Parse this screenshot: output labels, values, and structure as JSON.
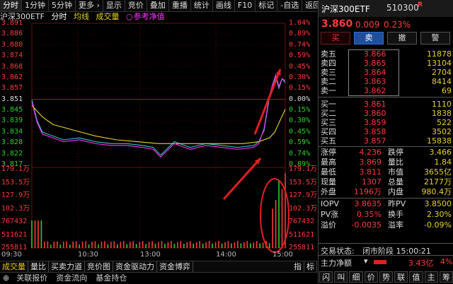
{
  "toolbar": {
    "items": [
      "分时",
      "1分钟",
      "5分钟",
      "更多 ›",
      "显示",
      "竞价",
      "叠加",
      "重播",
      "统计",
      "画线",
      "F10",
      "标记",
      "-自选"
    ],
    "back": "返回"
  },
  "chart": {
    "name": "沪深300ETF",
    "mode": "分时",
    "legend_avg": "均线",
    "legend_vol": "成交量",
    "legend_nav": "参考净值",
    "price_ticks": [
      "3.891",
      "3.886",
      "3.880",
      "3.874",
      "3.868",
      "3.862",
      "3.857",
      "3.851",
      "3.845",
      "3.839",
      "3.834",
      "3.828",
      "3.822",
      "3.817"
    ],
    "pct_ticks": [
      "1.04%",
      "0.89%",
      "0.74%",
      "0.59%",
      "0.45%",
      "0.30%",
      "0.15%",
      "0.00%",
      "0.15%",
      "0.30%",
      "0.45%",
      "0.59%",
      "0.74%",
      "0.89%"
    ],
    "vol_ticks": [
      "179.1万",
      "153.5万",
      "127.9万",
      "102.3万",
      "767432",
      "511621",
      "255811"
    ],
    "time_ticks": [
      "09:30",
      "10:30",
      "13:00",
      "14:00",
      "15:00"
    ],
    "colors": {
      "up": "#ff3b3b",
      "down": "#2bd12b",
      "price": "#ffffff",
      "avg": "#e6d32a",
      "nav": "#ff33ff",
      "vol_alt": "#2ec4c4",
      "circle": "#e02020"
    }
  },
  "chart_data": {
    "type": "line",
    "title": "沪深300ETF",
    "x_range": [
      "09:30",
      "15:00"
    ],
    "y_range": [
      3.817,
      3.891
    ],
    "prev_close": 3.851,
    "series": [
      {
        "name": "分时",
        "x": [
          0,
          5,
          10,
          20,
          30,
          45,
          60,
          75,
          90,
          105,
          115,
          120,
          122,
          135,
          150,
          165,
          180,
          195,
          210,
          215,
          220,
          225,
          228,
          231,
          234,
          237,
          240
        ],
        "values": [
          3.851,
          3.84,
          3.834,
          3.832,
          3.83,
          3.831,
          3.829,
          3.828,
          3.828,
          3.827,
          3.826,
          3.823,
          3.822,
          3.829,
          3.826,
          3.828,
          3.827,
          3.826,
          3.827,
          3.829,
          3.835,
          3.852,
          3.858,
          3.863,
          3.857,
          3.862,
          3.86
        ]
      },
      {
        "name": "均线",
        "x": [
          0,
          10,
          20,
          40,
          60,
          80,
          100,
          120,
          140,
          160,
          180,
          200,
          215,
          225,
          230,
          235,
          240
        ],
        "values": [
          3.848,
          3.842,
          3.838,
          3.835,
          3.832,
          3.83,
          3.829,
          3.828,
          3.828,
          3.828,
          3.828,
          3.828,
          3.829,
          3.831,
          3.834,
          3.84,
          3.846
        ]
      },
      {
        "name": "参考净值",
        "x": [
          0,
          5,
          10,
          20,
          30,
          45,
          60,
          75,
          90,
          105,
          115,
          120,
          122,
          135,
          150,
          165,
          180,
          195,
          210,
          215,
          220,
          225,
          228,
          231,
          234,
          237,
          240
        ],
        "values": [
          3.85,
          3.839,
          3.833,
          3.831,
          3.829,
          3.83,
          3.828,
          3.827,
          3.827,
          3.826,
          3.825,
          3.822,
          3.821,
          3.828,
          3.825,
          3.827,
          3.826,
          3.825,
          3.826,
          3.828,
          3.836,
          3.853,
          3.859,
          3.864,
          3.858,
          3.862,
          3.861
        ]
      }
    ],
    "volume": {
      "ylim": [
        0,
        1791000
      ]
    }
  },
  "bottom_tabs": [
    "成交量",
    "量比",
    "买卖力道",
    "竞价图",
    "资金驱动力",
    "资金博弈"
  ],
  "bottom_right": [
    "指",
    "标"
  ],
  "bottom_links": [
    "关联报价",
    "资金流向",
    "基金持仓"
  ],
  "quote": {
    "name": "沪深300ETF",
    "code": "510300",
    "badge": "R",
    "price": "3.860",
    "change": "0.009",
    "pct": "0.23%",
    "buttons": [
      "买",
      "卖",
      "撤",
      "警"
    ],
    "asks": [
      {
        "label": "卖五",
        "price": "3.866",
        "vol": "11878"
      },
      {
        "label": "卖四",
        "price": "3.865",
        "vol": "13104"
      },
      {
        "label": "卖三",
        "price": "3.864",
        "vol": "2704"
      },
      {
        "label": "卖二",
        "price": "3.863",
        "vol": "8414"
      },
      {
        "label": "卖一",
        "price": "3.862",
        "vol": "69"
      }
    ],
    "bids": [
      {
        "label": "买一",
        "price": "3.861",
        "vol": "1110"
      },
      {
        "label": "买二",
        "price": "3.860",
        "vol": "1838"
      },
      {
        "label": "买三",
        "price": "3.859",
        "vol": "522"
      },
      {
        "label": "买四",
        "price": "3.858",
        "vol": "3502"
      },
      {
        "label": "买五",
        "price": "3.857",
        "vol": "15838"
      }
    ],
    "stats": [
      {
        "l1": "涨停",
        "v1": "4.236",
        "l2": "跌停",
        "v2": "3.466"
      },
      {
        "l1": "最高",
        "v1": "3.869",
        "l2": "量比",
        "v2": "1.84"
      },
      {
        "l1": "最低",
        "v1": "3.811",
        "l2": "市值",
        "v2": "3655亿"
      },
      {
        "l1": "现量",
        "v1": "1307",
        "l2": "总量",
        "v2": "2177万"
      },
      {
        "l1": "外盘",
        "v1": "1196万",
        "l2": "内盘",
        "v2": "980.4万"
      }
    ],
    "iopv": [
      {
        "l1": "IOPV",
        "v1": "3.8635",
        "l2": "昨PV",
        "v2": "3.8500"
      },
      {
        "l1": "PV涨",
        "v1": "0.35%",
        "l2": "换手",
        "v2": "2.30%"
      },
      {
        "l1": "溢价",
        "v1": "-0.0035",
        "l2": "溢率",
        "v2": "-0.09%"
      }
    ],
    "status_label": "交易状态:",
    "status_value": "闭市阶段 15:00:21",
    "netflow_label": "主力净额",
    "netflow_value": "3.43亿",
    "netflow_pct": "4%",
    "bottom_icons": [
      "闪",
      "叫",
      "细",
      "价",
      "势",
      "联",
      "值",
      "主",
      "筹"
    ]
  }
}
